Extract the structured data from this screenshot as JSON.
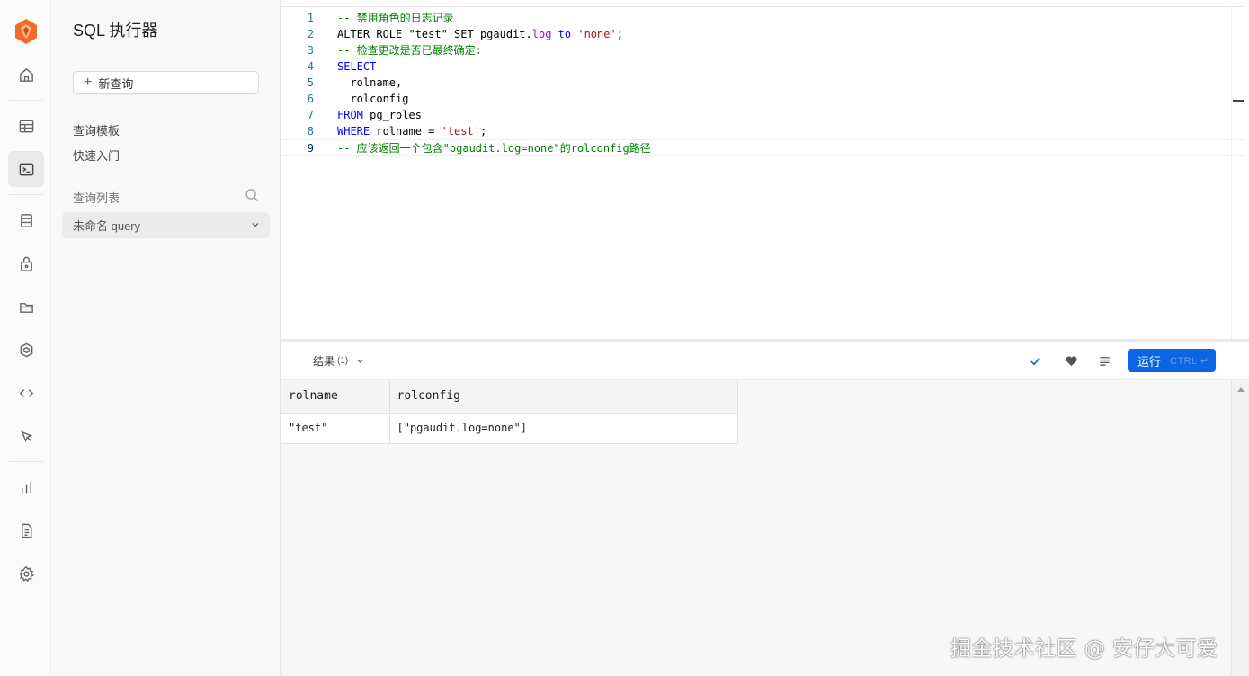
{
  "sidebar": {
    "title": "SQL 执行器",
    "new_query_label": "新查询",
    "links": [
      "查询模板",
      "快速入门"
    ],
    "section_label": "查询列表",
    "query_item": "未命名 query"
  },
  "nav_icons": [
    "home-icon",
    "table-editor-icon",
    "sql-editor-icon",
    "database-icon",
    "auth-icon",
    "storage-icon",
    "edge-functions-icon",
    "api-code-icon",
    "realtime-pointer-icon",
    "reports-icon",
    "logs-icon",
    "settings-icon"
  ],
  "editor": {
    "line_numbers": [
      "1",
      "2",
      "3",
      "4",
      "5",
      "6",
      "7",
      "8",
      "9"
    ],
    "lines": [
      [
        {
          "t": "-- 禁用角色的日志记录",
          "c": "cm"
        }
      ],
      [
        {
          "t": "ALTER ROLE \"test\" SET pgaudit.",
          "c": ""
        },
        {
          "t": "log",
          "c": "prop"
        },
        {
          "t": " ",
          "c": ""
        },
        {
          "t": "to",
          "c": "kw"
        },
        {
          "t": " ",
          "c": ""
        },
        {
          "t": "'none'",
          "c": "str"
        },
        {
          "t": ";",
          "c": ""
        }
      ],
      [
        {
          "t": "-- 检查更改是否已最终确定:",
          "c": "cm"
        }
      ],
      [
        {
          "t": "SELECT",
          "c": "kw"
        }
      ],
      [
        {
          "t": "  rolname,",
          "c": ""
        }
      ],
      [
        {
          "t": "  rolconfig",
          "c": ""
        }
      ],
      [
        {
          "t": "FROM",
          "c": "kw"
        },
        {
          "t": " pg_roles",
          "c": ""
        }
      ],
      [
        {
          "t": "WHERE",
          "c": "kw"
        },
        {
          "t": " rolname = ",
          "c": ""
        },
        {
          "t": "'test'",
          "c": "str"
        },
        {
          "t": ";",
          "c": ""
        }
      ],
      [
        {
          "t": "-- 应该返回一个包含\"pgaudit.log=none\"的rolconfig路径",
          "c": "cm"
        }
      ]
    ]
  },
  "results": {
    "label": "结果",
    "count": "(1)",
    "run_label": "运行",
    "run_shortcut": "CTRL ↵",
    "columns": [
      "rolname",
      "rolconfig"
    ],
    "rows": [
      [
        "\"test\"",
        "[\"pgaudit.log=none\"]"
      ]
    ]
  },
  "colors": {
    "primary": "#0b66e4",
    "logo": "#f26b2a",
    "check": "#0b66e4"
  },
  "watermark": "掘金技术社区 @ 安仔大可爱"
}
